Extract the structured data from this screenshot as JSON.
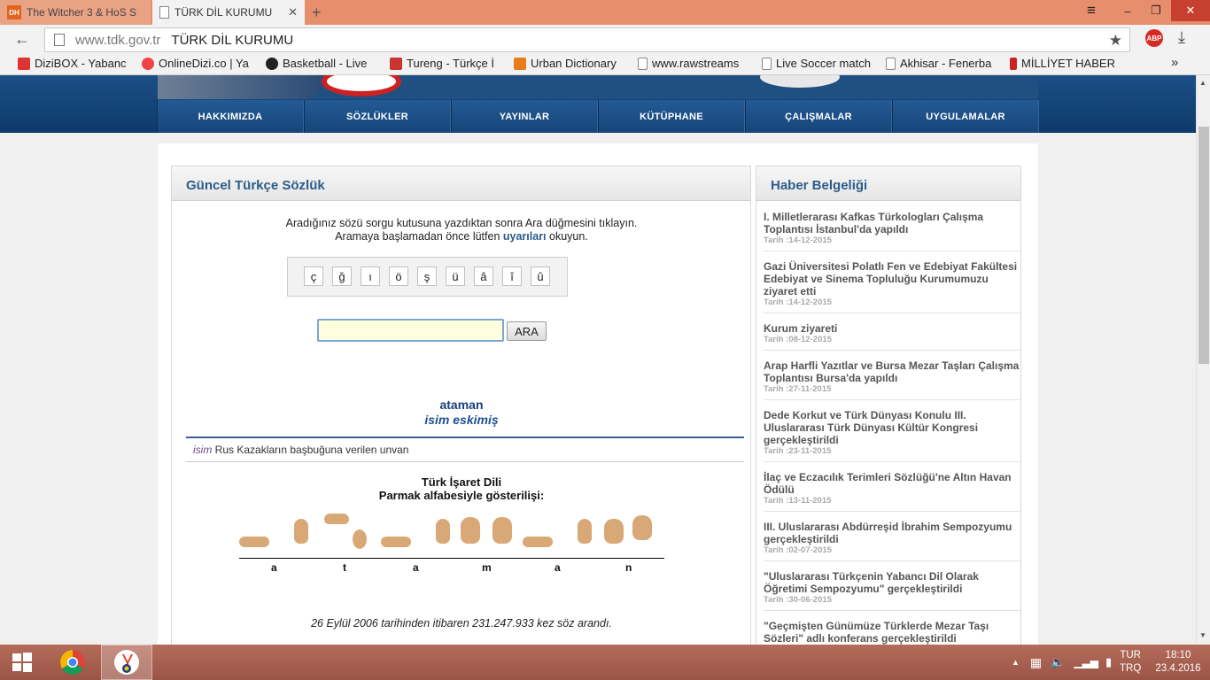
{
  "browser": {
    "tabs": [
      {
        "title": "The Witcher 3 & HoS S",
        "icon_text": "DH",
        "active": false
      },
      {
        "title": "TÜRK DİL KURUMU",
        "active": true
      }
    ],
    "new_tab_symbol": "+",
    "window_controls": {
      "hamburger": "≡",
      "minimize": "–",
      "maximize": "❐",
      "close": "✕"
    },
    "address": {
      "domain": "www.tdk.gov.tr",
      "title": "TÜRK DİL KURUMU"
    },
    "back_symbol": "←",
    "reload_symbol": "↻",
    "star_symbol": "★",
    "abp_label": "ABP",
    "download_symbol": "⤓",
    "bookmarks": [
      {
        "label": "DiziBOX - Yabanc",
        "icon": "tv-icon",
        "color": "#d33"
      },
      {
        "label": "OnlineDizi.co | Ya",
        "icon": "play-icon",
        "color": "#e44"
      },
      {
        "label": "Basketball - Live",
        "icon": "bat-icon",
        "color": "#222"
      },
      {
        "label": "Tureng - Türkçe İ",
        "icon": "book-icon",
        "color": "#c33"
      },
      {
        "label": "Urban Dictionary",
        "icon": "ud-icon",
        "color": "#e87d1e"
      },
      {
        "label": "www.rawstreams",
        "icon": "page-icon",
        "color": "#fff"
      },
      {
        "label": "Live Soccer match",
        "icon": "page-icon",
        "color": "#fff"
      },
      {
        "label": "Akhisar - Fenerba",
        "icon": "page-icon",
        "color": "#fff"
      },
      {
        "label": "MİLLİYET HABER",
        "icon": "milliyet-icon",
        "color": "#c22"
      }
    ],
    "bookmarks_more": "»"
  },
  "site": {
    "menu": [
      "HAKKIMIZDA",
      "SÖZLÜKLER",
      "YAYINLAR",
      "KÜTÜPHANE",
      "ÇALIŞMALAR",
      "UYGULAMALAR"
    ],
    "dictionary": {
      "heading": "Güncel Türkçe Sözlük",
      "instruction_line1": "Aradığınız sözü sorgu kutusuna yazdıktan sonra Ara düğmesini tıklayın.",
      "instruction_line2_pre": "Aramaya başlamadan önce lütfen ",
      "instruction_link": "uyarıları",
      "instruction_line2_post": " okuyun.",
      "keys": [
        "ç",
        "ğ",
        "ı",
        "ö",
        "ş",
        "ü",
        "â",
        "î",
        "û"
      ],
      "search_value": "",
      "search_button": "ARA",
      "word": "ataman",
      "word_info": "isim eskimiş",
      "meaning_pos": "isim",
      "meaning_text": "Rus Kazakların başbuğuna verilen unvan",
      "sign_title": "Türk İşaret Dili",
      "sign_subtitle": "Parmak alfabesiyle gösterilişi:",
      "sign_letters": [
        "a",
        "t",
        "a",
        "m",
        "a",
        "n"
      ],
      "stats": "26 Eylül 2006 tarihinden itibaren 231.247.933 kez söz arandı."
    },
    "news": {
      "heading": "Haber Belgeliği",
      "items": [
        {
          "title": "I. Milletlerarası Kafkas Türkologları Çalışma Toplantısı İstanbul'da yapıldı",
          "date": "Tarih :14-12-2015"
        },
        {
          "title": "Gazi Üniversitesi Polatlı Fen ve Edebiyat Fakültesi Edebiyat ve Sinema Topluluğu Kurumumuzu ziyaret etti",
          "date": "Tarih :14-12-2015"
        },
        {
          "title": "Kurum ziyareti",
          "date": "Tarih :08-12-2015"
        },
        {
          "title": "Arap Harfli Yazıtlar ve Bursa Mezar Taşları Çalışma Toplantısı Bursa'da yapıldı",
          "date": "Tarih :27-11-2015"
        },
        {
          "title": "Dede Korkut ve Türk Dünyası Konulu III. Uluslararası Türk Dünyası Kültür Kongresi gerçekleştirildi",
          "date": "Tarih :23-11-2015"
        },
        {
          "title": "İlaç ve Eczacılık Terimleri Sözlüğü'ne Altın Havan Ödülü",
          "date": "Tarih :13-11-2015"
        },
        {
          "title": "III. Uluslararası Abdürreşid İbrahim Sempozyumu gerçekleştirildi",
          "date": "Tarih :02-07-2015"
        },
        {
          "title": "\"Uluslararası Türkçenin Yabancı Dil Olarak Öğretimi Sempozyumu\" gerçekleştirildi",
          "date": "Tarih :30-06-2015"
        },
        {
          "title": "\"Geçmişten Günümüze Türklerde Mezar Taşı Sözleri\" adlı konferans gerçekleştirildi",
          "date": ""
        }
      ]
    }
  },
  "taskbar": {
    "language": "TUR",
    "keyboard": "TRQ",
    "time": "18:10",
    "date": "23.4.2016"
  }
}
